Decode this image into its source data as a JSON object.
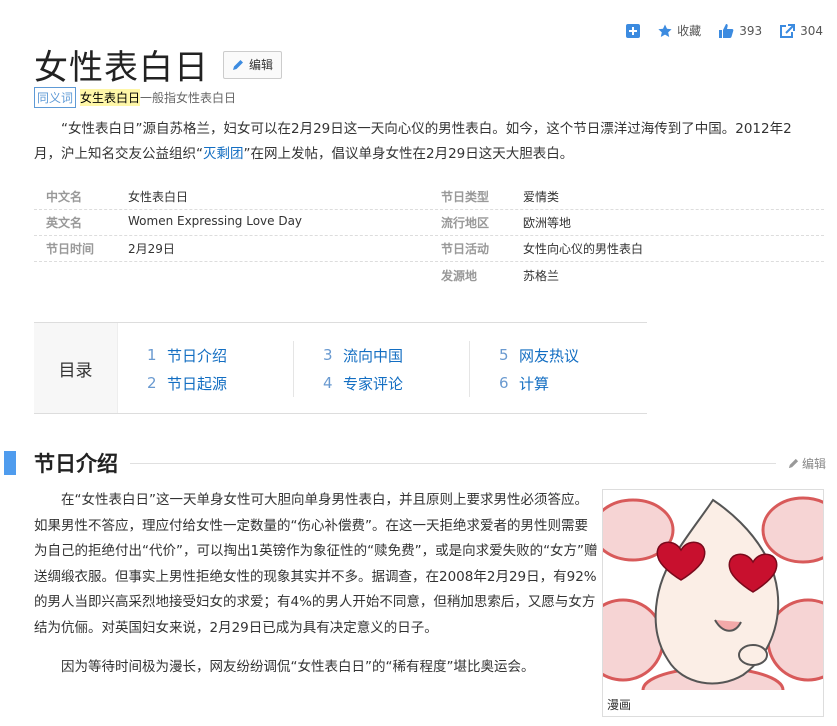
{
  "actions": {
    "add_icon": "plus-square-icon",
    "favorite_label": "收藏",
    "like_count": "393",
    "share_count": "304"
  },
  "title": "女性表白日",
  "edit_label": "编辑",
  "synonym": {
    "tag": "同义词",
    "term": "女生表白日",
    "rest": "一般指女性表白日"
  },
  "intro": {
    "p1_a": "“女性表白日”源自苏格兰，妇女可以在2月29日这一天向心仪的男性表白。如今，这个节日漂洋过海传到了中国。2012年2月，沪上知名交友公益组织“",
    "p1_link": "灭剩团",
    "p1_b": "”在网上发帖，倡议单身女性在2月29日这天大胆表白。"
  },
  "info": [
    [
      {
        "k": "中文名",
        "v": "女性表白日"
      },
      {
        "k": "节日类型",
        "v": "爱情类"
      }
    ],
    [
      {
        "k": "英文名",
        "v": "Women Expressing Love Day"
      },
      {
        "k": "流行地区",
        "v": "欧洲等地"
      }
    ],
    [
      {
        "k": "节日时间",
        "v": "2月29日"
      },
      {
        "k": "节日活动",
        "v": "女性向心仪的男性表白"
      }
    ],
    [
      {
        "k": "",
        "v": ""
      },
      {
        "k": "发源地",
        "v": "苏格兰"
      }
    ]
  ],
  "catalog": {
    "head": "目录",
    "items": [
      {
        "num": "1",
        "label": "节日介绍"
      },
      {
        "num": "2",
        "label": "节日起源"
      },
      {
        "num": "3",
        "label": "流向中国"
      },
      {
        "num": "4",
        "label": "专家评论"
      },
      {
        "num": "5",
        "label": "网友热议"
      },
      {
        "num": "6",
        "label": "计算"
      }
    ]
  },
  "section": {
    "title": "节日介绍",
    "edit_label": "编辑"
  },
  "body": {
    "p1": "在“女性表白日”这一天单身女性可大胆向单身男性表白，并且原则上要求男性必须答应。如果男性不答应，理应付给女性一定数量的“伤心补偿费”。在这一天拒绝求爱者的男性则需要为自己的拒绝付出“代价”，可以掏出1英镑作为象征性的“赎免费”，或是向求爱失败的“女方”赠送绸缎衣服。但事实上男性拒绝女性的现象其实并不多。据调查，在2008年2月29日，有92%的男人当即兴高采烈地接受妇女的求爱；有4%的男人开始不同意，但稍加思索后，又愿与女方结为伉俪。对英国妇女来说，2月29日已成为具有决定意义的日子。",
    "p2": "因为等待时间极为漫长，网友纷纷调侃“女性表白日”的“稀有程度”堪比奥运会。"
  },
  "figure": {
    "caption": "漫画"
  }
}
